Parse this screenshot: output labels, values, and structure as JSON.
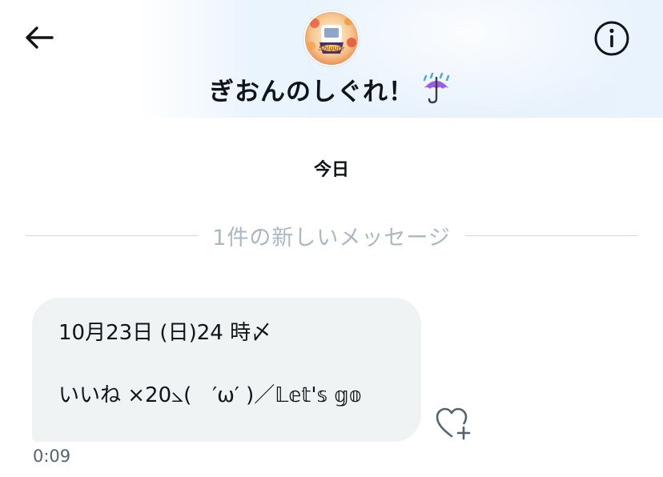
{
  "header": {
    "conversation_name": "ぎおんのしぐれ！",
    "title_emoji": "☔",
    "back_icon": "arrow-left-icon",
    "info_icon": "info-circle-icon",
    "avatar_icon": "profile-avatar"
  },
  "thread": {
    "date_label": "今日",
    "new_messages_label": "1件の新しいメッセージ"
  },
  "message": {
    "line1": "10月23日 (日)24 時〆",
    "line2": "いいね ×20⦣(　′ω′ )／𝕃𝕖𝕥'𝕤 𝕘𝕠",
    "timestamp": "0:09",
    "react_icon": "heart-plus-icon"
  },
  "colors": {
    "accent": "#1d9bf0",
    "bubble": "#eff3f4",
    "divider_text": "#aab8c2",
    "timestamp": "#536471",
    "header_tint": "#e6f1fc"
  }
}
